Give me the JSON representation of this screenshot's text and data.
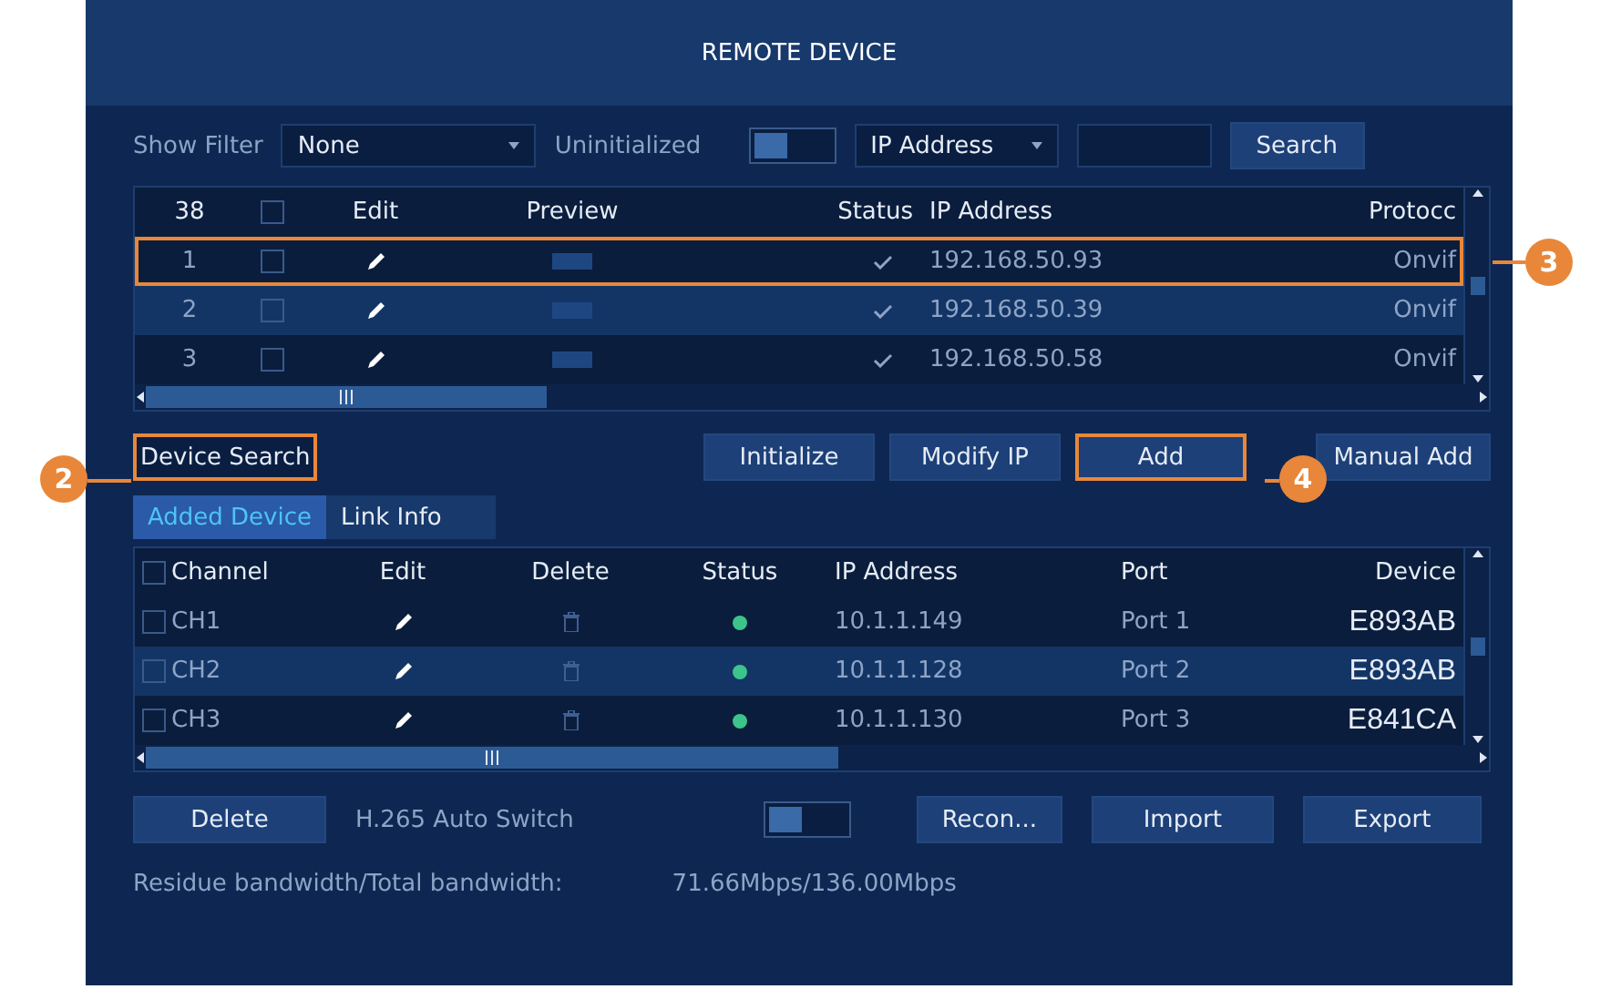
{
  "window": {
    "title": "REMOTE DEVICE"
  },
  "filter": {
    "label": "Show Filter",
    "value": "None",
    "uninitialized_label": "Uninitialized",
    "uninitialized_on": false,
    "search_by": "IP Address",
    "search_button": "Search"
  },
  "devices": {
    "columns": [
      "38",
      "Edit",
      "Preview",
      "Status",
      "IP Address",
      "Protocc"
    ],
    "all_checked": false,
    "rows": [
      {
        "number": "1",
        "checked": false,
        "ip": "192.168.50.93",
        "protocol": "Onvif",
        "callout": "3"
      },
      {
        "number": "2",
        "checked": false,
        "ip": "192.168.50.39",
        "protocol": "Onvif"
      },
      {
        "number": "3",
        "checked": false,
        "ip": "192.168.50.58",
        "protocol": "Onvif"
      }
    ]
  },
  "actions": [
    {
      "label": "Device Search",
      "kind": "link",
      "callout": "2"
    },
    {
      "label": "Initialize",
      "kind": "button"
    },
    {
      "label": "Modify IP",
      "kind": "button"
    },
    {
      "label": "Add",
      "kind": "button",
      "callout": "4"
    },
    {
      "label": "Manual Add",
      "kind": "button"
    }
  ],
  "tabs": [
    {
      "label": "Added Device",
      "selected": true
    },
    {
      "label": "Link Info",
      "selected": false
    }
  ],
  "added": {
    "columns": [
      "Channel",
      "Edit",
      "Delete",
      "Status",
      "IP Address",
      "Port",
      "Device"
    ],
    "all_checked": false,
    "rows": [
      {
        "channel": "CH1",
        "checked": false,
        "online": true,
        "ip": "10.1.1.149",
        "port": "Port 1",
        "device": "E893AB"
      },
      {
        "channel": "CH2",
        "checked": false,
        "online": true,
        "ip": "10.1.1.128",
        "port": "Port 2",
        "device": "E893AB"
      },
      {
        "channel": "CH3",
        "checked": false,
        "online": true,
        "ip": "10.1.1.130",
        "port": "Port 3",
        "device": "E841CA"
      }
    ]
  },
  "footer": {
    "delete_button": "Delete",
    "h265_label": "H.265 Auto Switch",
    "h265_on": false,
    "buttons": [
      "Recon...",
      "Import",
      "Export"
    ],
    "bandwidth_label": "Residue bandwidth/Total bandwidth:",
    "bandwidth_value": "71.66Mbps/136.00Mbps"
  }
}
